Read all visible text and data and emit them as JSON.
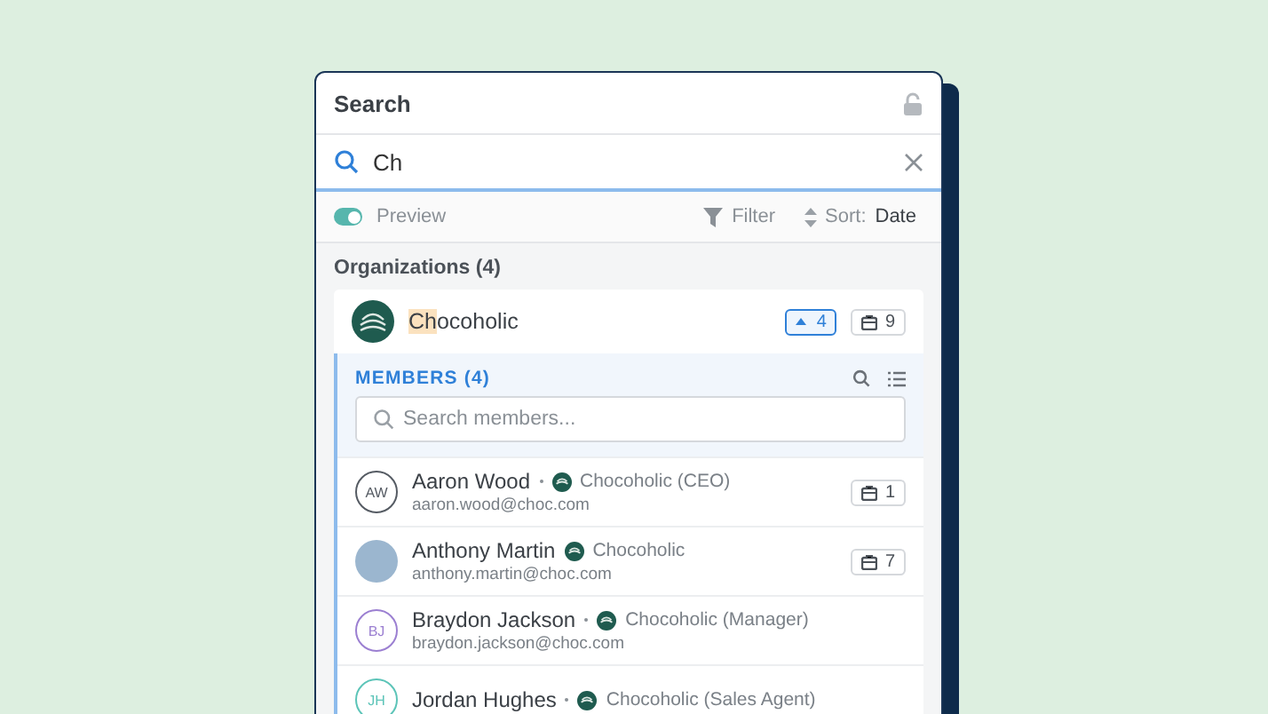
{
  "panel": {
    "title": "Search"
  },
  "search": {
    "value": "Ch"
  },
  "toolbar": {
    "preview": {
      "label": "Preview",
      "on": true
    },
    "filter": "Filter",
    "sort_label": "Sort:",
    "sort_value": "Date"
  },
  "section": {
    "title": "Organizations (4)"
  },
  "organization": {
    "match": "Ch",
    "rest": "ocoholic",
    "expanded": true,
    "badges": [
      {
        "kind": "up",
        "count": "4"
      },
      {
        "kind": "case",
        "count": "9"
      }
    ]
  },
  "members": {
    "title": "MEMBERS (4)",
    "placeholder": "Search members...",
    "rows": [
      {
        "kind": "initials",
        "initials": "AW",
        "color": "#555b63",
        "name": "Aaron Wood",
        "dot": true,
        "org": "Chocoholic (CEO)",
        "email": "aaron.wood@choc.com",
        "count": "1"
      },
      {
        "kind": "photo",
        "name": "Anthony Martin",
        "dot": false,
        "org": "Chocoholic",
        "email": "anthony.martin@choc.com",
        "count": "7"
      },
      {
        "kind": "initials",
        "initials": "BJ",
        "color": "#9b7fd1",
        "name": "Braydon Jackson",
        "dot": true,
        "org": "Chocoholic (Manager)",
        "email": "braydon.jackson@choc.com"
      },
      {
        "kind": "initials",
        "initials": "JH",
        "color": "#5cc4b8",
        "name": "Jordan Hughes",
        "dot": true,
        "org": "Chocoholic (Sales Agent)"
      }
    ]
  }
}
